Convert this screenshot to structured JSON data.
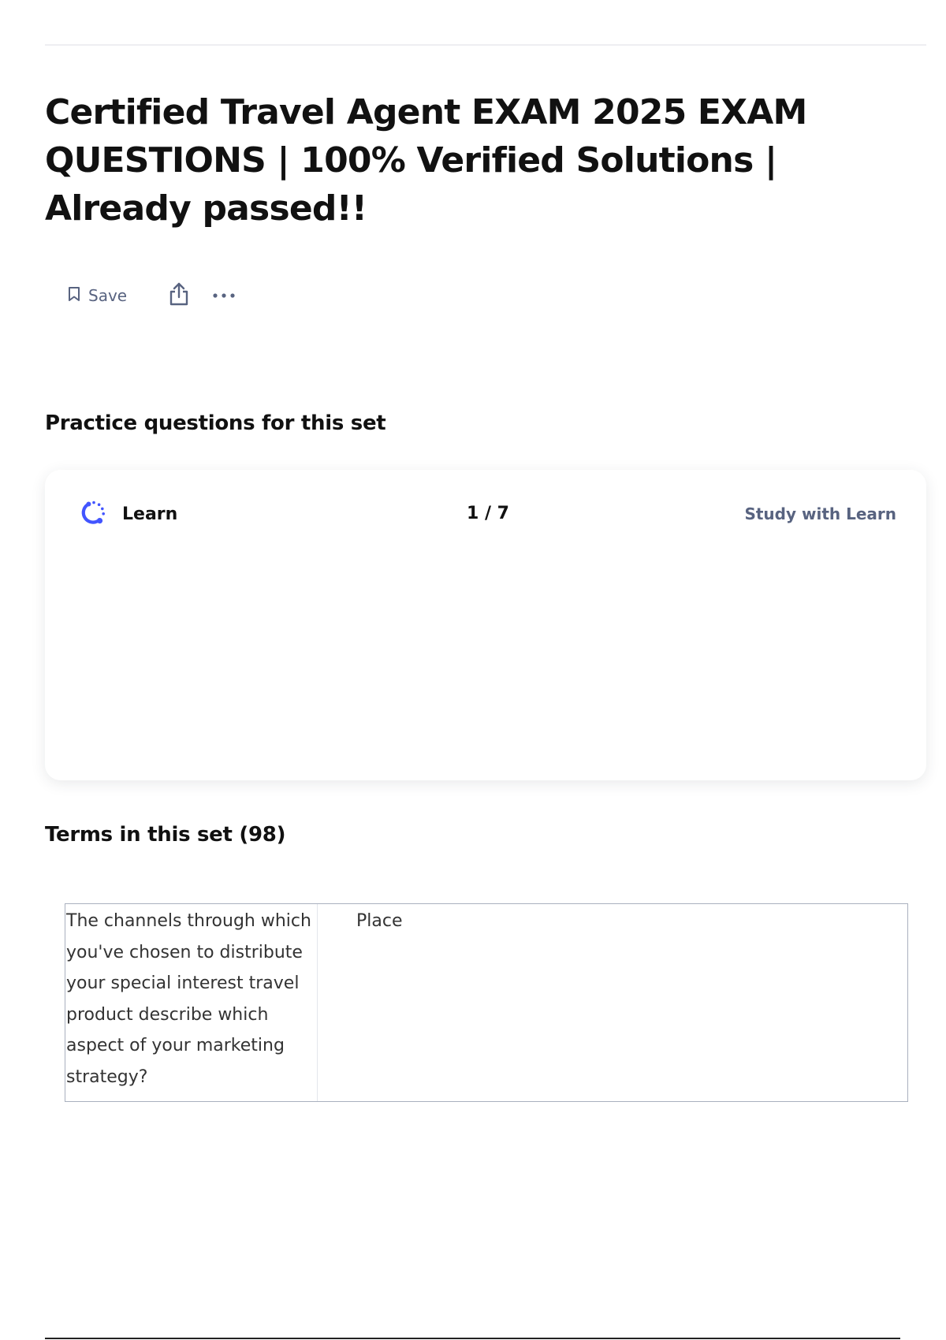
{
  "set": {
    "title": "Certified Travel Agent EXAM 2025 EXAM QUESTIONS | 100% Verified Solutions | Already passed!!"
  },
  "actions": {
    "save_label": "Save",
    "icons": [
      "bookmark-icon",
      "share-icon",
      "more-icon"
    ]
  },
  "practice": {
    "heading": "Practice questions for this set",
    "learn_label": "Learn",
    "progress": "1 / 7",
    "study_link": "Study with Learn",
    "accent_color": "#4255ff"
  },
  "terms": {
    "heading": "Terms in this set (98)",
    "items": [
      {
        "term": "The channels through which you've chosen to distribute your special interest travel product describe which aspect of your marketing strategy?",
        "definition": "Place"
      }
    ]
  }
}
